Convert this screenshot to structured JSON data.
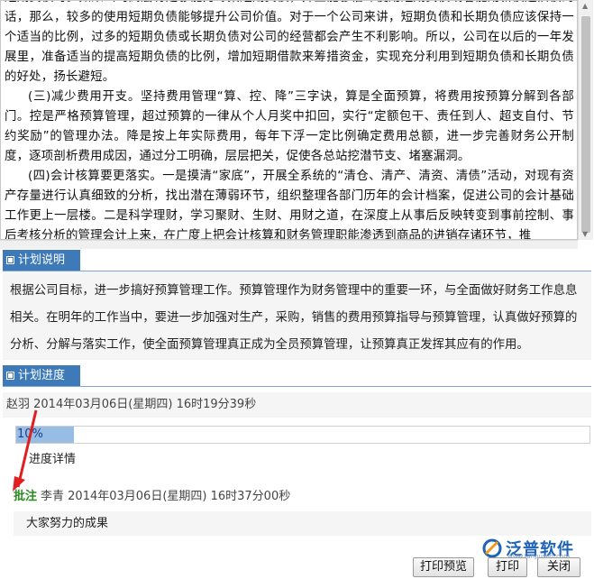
{
  "document": {
    "paragraphs": [
      {
        "indent": false,
        "text": "短期负债时。如果公司高层有足够能力筹集短期负债，并且能够借环使用短期负债或者能用新债还旧债的话，那么，较多的使用短期负债能够提升公司价值。对于一个公司来讲，短期负债和长期负债应该保持一个适当的比例，过多的短期负债或长期负债对公司的经营都会产生不利影响。所以，公司在以后的一年发展里，准备适当的提高短期负债的比例，增加短期借款来筹措资金，实现充分利用到短期负债和长期负债的好处，扬长避短。"
      },
      {
        "indent": true,
        "text": "(三)减少费用开支。坚持费用管理“算、控、降”三字诀，算是全面预算，将费用按预算分解到各部门。控是严格预算管理，超过预算的一律从个人月奖中扣回，实行“定额包干、责任到人、超支自付、节约奖励”的管理办法。降是按上年实际费用，每年下浮一定比例确定费用总额，进一步完善财务公开制度，逐项剖析费用成因，通过分工明确，层层把关，促使各总站挖潜节支、堵塞漏洞。"
      },
      {
        "indent": true,
        "text": "(四)会计核算要更落实。一是摸清“家底”，开展全系统的“清仓、清产、清资、清债”活动，对现有资产存量进行认真细致的分析，找出潜在薄弱环节，组织整理各部门历年的会计档案，促进公司的会计基础工作更上一层楼。二是科学理财，学习聚财、生财、用财之道，在深度上从事后反映转变到事前控制、事后考核分析的管理会计上来，在广度上把会计核算和财务管理职能渗透到商品的进销存诸环节，推"
      }
    ]
  },
  "plan_description": {
    "header": "计划说明",
    "text": "根据公司目标，进一步搞好预算管理工作。预算管理作为财务管理中的重要一环，与全面做好财务工作息息相关。在明年的工作当中，要进一步加强对生产，采购，销售的费用预算指导与预算管理，认真做好预算的分析、分解与落实工作，使全面预算管理真正成为全员预算管理，让预算真正发挥其应有的作用。"
  },
  "plan_progress": {
    "header": "计划进度",
    "author_line": "赵羽 2014年03月06日(星期四) 16时19分39秒",
    "progress_value": 0.1,
    "progress_label": "10%",
    "detail_label": "进度详情",
    "comment": {
      "tag": "批注",
      "meta": "李青 2014年03月06日(星期四) 16时37分00秒",
      "text": "大家努力的成果"
    }
  },
  "logo": {
    "name": "泛普软件",
    "url": "www.fanpusoft.com"
  },
  "buttons": {
    "print_preview": "打印预览",
    "print": "打印",
    "close": "关闭"
  },
  "colors": {
    "header_bg": "#3e79b8",
    "progress_fill": "#97bde4",
    "comment_tag": "#2a8a1e",
    "annotation_arrow": "#e02020"
  }
}
